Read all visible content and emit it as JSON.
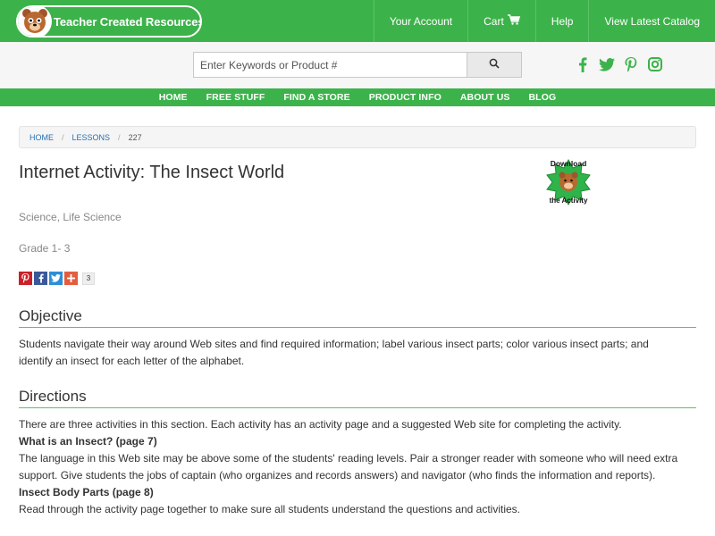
{
  "header": {
    "logo_text": "Teacher Created Resources",
    "nav": [
      "Your Account",
      "Cart",
      "Help",
      "View Latest Catalog"
    ]
  },
  "search": {
    "placeholder": "Enter Keywords or Product #"
  },
  "social_icons": [
    "facebook-icon",
    "twitter-icon",
    "pinterest-icon",
    "instagram-icon"
  ],
  "main_nav": [
    "HOME",
    "FREE STUFF",
    "FIND A STORE",
    "PRODUCT INFO",
    "ABOUT US",
    "BLOG"
  ],
  "breadcrumb": {
    "items": [
      "HOME",
      "LESSONS"
    ],
    "current": "227"
  },
  "lesson": {
    "title": "Internet Activity: The Insect World",
    "download_line1": "Download",
    "download_line2": "the Activity",
    "subject": "Science, Life Science",
    "grade": "Grade 1- 3",
    "share_count": "3"
  },
  "objective": {
    "heading": "Objective",
    "text": "Students navigate their way around Web sites and find required information; label various insect parts; color various insect parts; and identify an insect for each letter of the alphabet."
  },
  "directions": {
    "heading": "Directions",
    "intro": "There are three activities in this section. Each activity has an activity page and a suggested Web site for completing the activity.",
    "sub1_title": "What is an Insect? (page 7)",
    "sub1_text": "The language in this Web site may be above some of the students' reading levels. Pair a stronger reader with someone who will need extra support. Give students the jobs of captain (who organizes and records answers) and navigator (who finds the information and reports).",
    "sub2_title": "Insect Body Parts (page 8)",
    "sub2_text": "Read through the activity page together to make sure all students understand the questions and activities."
  },
  "colors": {
    "brand_green": "#3cb34a",
    "link_blue": "#2a6fb3"
  }
}
